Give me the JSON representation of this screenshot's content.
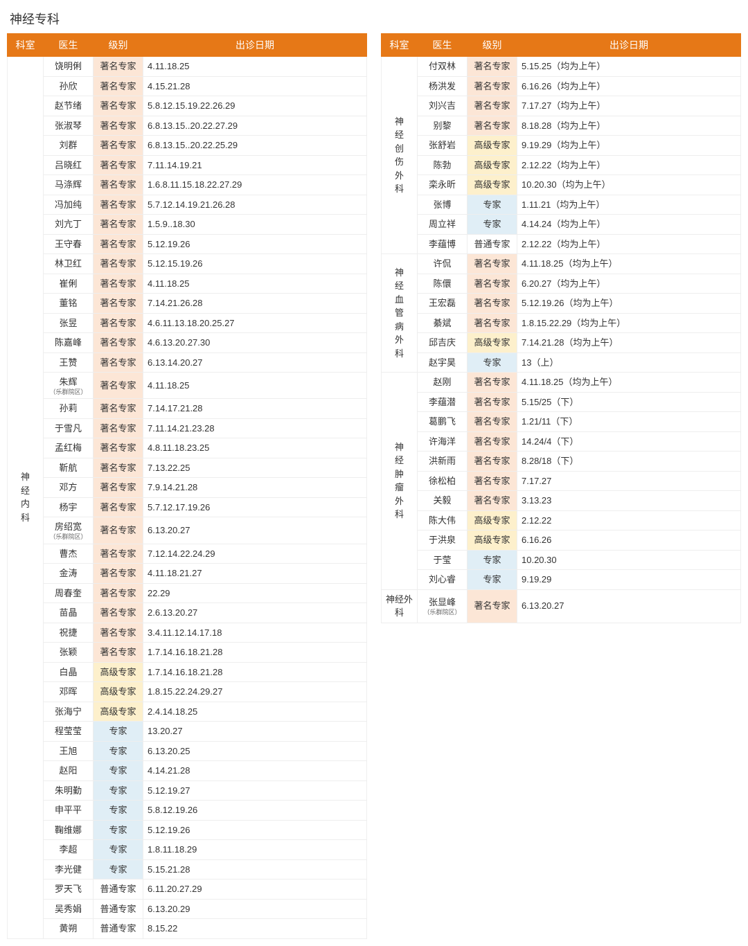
{
  "title": "神经专科",
  "headers": {
    "dept": "科室",
    "doctor": "医生",
    "level": "级别",
    "dates": "出诊日期"
  },
  "level_labels": {
    "famous": "著名专家",
    "senior": "高级专家",
    "expert": "专家",
    "normal": "普通专家"
  },
  "left": {
    "dept": "神经内科",
    "rows": [
      {
        "doctor": "饶明俐",
        "level": "famous",
        "dates": "4.11.18.25"
      },
      {
        "doctor": "孙欣",
        "level": "famous",
        "dates": "4.15.21.28"
      },
      {
        "doctor": "赵节绪",
        "level": "famous",
        "dates": "5.8.12.15.19.22.26.29"
      },
      {
        "doctor": "张淑琴",
        "level": "famous",
        "dates": "6.8.13.15..20.22.27.29"
      },
      {
        "doctor": "刘群",
        "level": "famous",
        "dates": "6.8.13.15..20.22.25.29"
      },
      {
        "doctor": "吕晓红",
        "level": "famous",
        "dates": "7.11.14.19.21"
      },
      {
        "doctor": "马涤辉",
        "level": "famous",
        "dates": "1.6.8.11.15.18.22.27.29"
      },
      {
        "doctor": "冯加纯",
        "level": "famous",
        "dates": "5.7.12.14.19.21.26.28"
      },
      {
        "doctor": "刘亢丁",
        "level": "famous",
        "dates": "1.5.9..18.30"
      },
      {
        "doctor": "王守春",
        "level": "famous",
        "dates": "5.12.19.26"
      },
      {
        "doctor": "林卫红",
        "level": "famous",
        "dates": "5.12.15.19.26"
      },
      {
        "doctor": "崔俐",
        "level": "famous",
        "dates": "4.11.18.25"
      },
      {
        "doctor": "董铭",
        "level": "famous",
        "dates": "7.14.21.26.28"
      },
      {
        "doctor": "张昱",
        "level": "famous",
        "dates": "4.6.11.13.18.20.25.27"
      },
      {
        "doctor": "陈嘉峰",
        "level": "famous",
        "dates": "4.6.13.20.27.30"
      },
      {
        "doctor": "王赞",
        "level": "famous",
        "dates": "6.13.14.20.27"
      },
      {
        "doctor": "朱辉",
        "note": "（乐群院区）",
        "level": "famous",
        "dates": "4.11.18.25"
      },
      {
        "doctor": "孙莉",
        "level": "famous",
        "dates": "7.14.17.21.28"
      },
      {
        "doctor": "于雪凡",
        "level": "famous",
        "dates": "7.11.14.21.23.28"
      },
      {
        "doctor": "孟红梅",
        "level": "famous",
        "dates": "4.8.11.18.23.25"
      },
      {
        "doctor": "靳航",
        "level": "famous",
        "dates": "7.13.22.25"
      },
      {
        "doctor": "邓方",
        "level": "famous",
        "dates": "7.9.14.21.28"
      },
      {
        "doctor": "杨宇",
        "level": "famous",
        "dates": "5.7.12.17.19.26"
      },
      {
        "doctor": "房绍宽",
        "note": "（乐群院区）",
        "level": "famous",
        "dates": "6.13.20.27"
      },
      {
        "doctor": "曹杰",
        "level": "famous",
        "dates": "7.12.14.22.24.29"
      },
      {
        "doctor": "金涛",
        "level": "famous",
        "dates": "4.11.18.21.27"
      },
      {
        "doctor": "周春奎",
        "level": "famous",
        "dates": "22.29"
      },
      {
        "doctor": "苗晶",
        "level": "famous",
        "dates": "2.6.13.20.27"
      },
      {
        "doctor": "祝捷",
        "level": "famous",
        "dates": "3.4.11.12.14.17.18"
      },
      {
        "doctor": "张颖",
        "level": "famous",
        "dates": "1.7.14.16.18.21.28"
      },
      {
        "doctor": "白晶",
        "level": "senior",
        "dates": "1.7.14.16.18.21.28"
      },
      {
        "doctor": "邓晖",
        "level": "senior",
        "dates": "1.8.15.22.24.29.27"
      },
      {
        "doctor": "张海宁",
        "level": "senior",
        "dates": "2.4.14.18.25"
      },
      {
        "doctor": "程莹莹",
        "level": "expert",
        "dates": "13.20.27"
      },
      {
        "doctor": "王旭",
        "level": "expert",
        "dates": "6.13.20.25"
      },
      {
        "doctor": "赵阳",
        "level": "expert",
        "dates": "4.14.21.28"
      },
      {
        "doctor": "朱明勤",
        "level": "expert",
        "dates": "5.12.19.27"
      },
      {
        "doctor": "申平平",
        "level": "expert",
        "dates": "5.8.12.19.26"
      },
      {
        "doctor": "鞠维娜",
        "level": "expert",
        "dates": "5.12.19.26"
      },
      {
        "doctor": "李超",
        "level": "expert",
        "dates": "1.8.11.18.29"
      },
      {
        "doctor": "李光健",
        "level": "expert",
        "dates": "5.15.21.28"
      },
      {
        "doctor": "罗天飞",
        "level": "normal",
        "dates": "6.11.20.27.29"
      },
      {
        "doctor": "吴秀娟",
        "level": "normal",
        "dates": "6.13.20.29"
      },
      {
        "doctor": "黄朔",
        "level": "normal",
        "dates": "8.15.22"
      }
    ]
  },
  "right": [
    {
      "dept": "神经创伤外科",
      "rows": [
        {
          "doctor": "付双林",
          "level": "famous",
          "dates": "5.15.25（均为上午）"
        },
        {
          "doctor": "杨洪发",
          "level": "famous",
          "dates": "6.16.26（均为上午）"
        },
        {
          "doctor": "刘兴吉",
          "level": "famous",
          "dates": "7.17.27（均为上午）"
        },
        {
          "doctor": "别黎",
          "level": "famous",
          "dates": "8.18.28（均为上午）"
        },
        {
          "doctor": "张舒岩",
          "level": "senior",
          "dates": "9.19.29（均为上午）"
        },
        {
          "doctor": "陈勃",
          "level": "senior",
          "dates": "2.12.22（均为上午）"
        },
        {
          "doctor": "栾永昕",
          "level": "senior",
          "dates": "10.20.30（均为上午）"
        },
        {
          "doctor": "张博",
          "level": "expert",
          "dates": "1.11.21（均为上午）"
        },
        {
          "doctor": "周立祥",
          "level": "expert",
          "dates": "4.14.24（均为上午）"
        },
        {
          "doctor": "李蕴博",
          "level": "normal",
          "dates": "2.12.22（均为上午）"
        }
      ]
    },
    {
      "dept": "神经血管病外科",
      "rows": [
        {
          "doctor": "许侃",
          "level": "famous",
          "dates": "4.11.18.25（均为上午）"
        },
        {
          "doctor": "陈儇",
          "level": "famous",
          "dates": "6.20.27（均为上午）"
        },
        {
          "doctor": "王宏磊",
          "level": "famous",
          "dates": "5.12.19.26（均为上午）"
        },
        {
          "doctor": "綦斌",
          "level": "famous",
          "dates": "1.8.15.22.29（均为上午）"
        },
        {
          "doctor": "邱吉庆",
          "level": "senior",
          "dates": "7.14.21.28（均为上午）"
        },
        {
          "doctor": "赵宇昊",
          "level": "expert",
          "dates": "13（上）"
        }
      ]
    },
    {
      "dept": "神经肿瘤外科",
      "rows": [
        {
          "doctor": "赵刚",
          "level": "famous",
          "dates": "4.11.18.25（均为上午）"
        },
        {
          "doctor": "李蕴潜",
          "level": "famous",
          "dates": "5.15/25（下）"
        },
        {
          "doctor": "葛鹏飞",
          "level": "famous",
          "dates": "1.21/11（下）"
        },
        {
          "doctor": "许海洋",
          "level": "famous",
          "dates": "14.24/4（下）"
        },
        {
          "doctor": "洪新雨",
          "level": "famous",
          "dates": "8.28/18（下）"
        },
        {
          "doctor": "徐松柏",
          "level": "famous",
          "dates": "7.17.27"
        },
        {
          "doctor": "关毅",
          "level": "famous",
          "dates": "3.13.23"
        },
        {
          "doctor": "陈大伟",
          "level": "senior",
          "dates": "2.12.22"
        },
        {
          "doctor": "于洪泉",
          "level": "senior",
          "dates": "6.16.26"
        },
        {
          "doctor": "于莹",
          "level": "expert",
          "dates": "10.20.30"
        },
        {
          "doctor": "刘心睿",
          "level": "expert",
          "dates": "9.19.29"
        }
      ]
    },
    {
      "dept": "神经外科",
      "rows": [
        {
          "doctor": "张显峰",
          "note": "（乐群院区）",
          "level": "famous",
          "dates": "6.13.20.27"
        }
      ]
    }
  ]
}
